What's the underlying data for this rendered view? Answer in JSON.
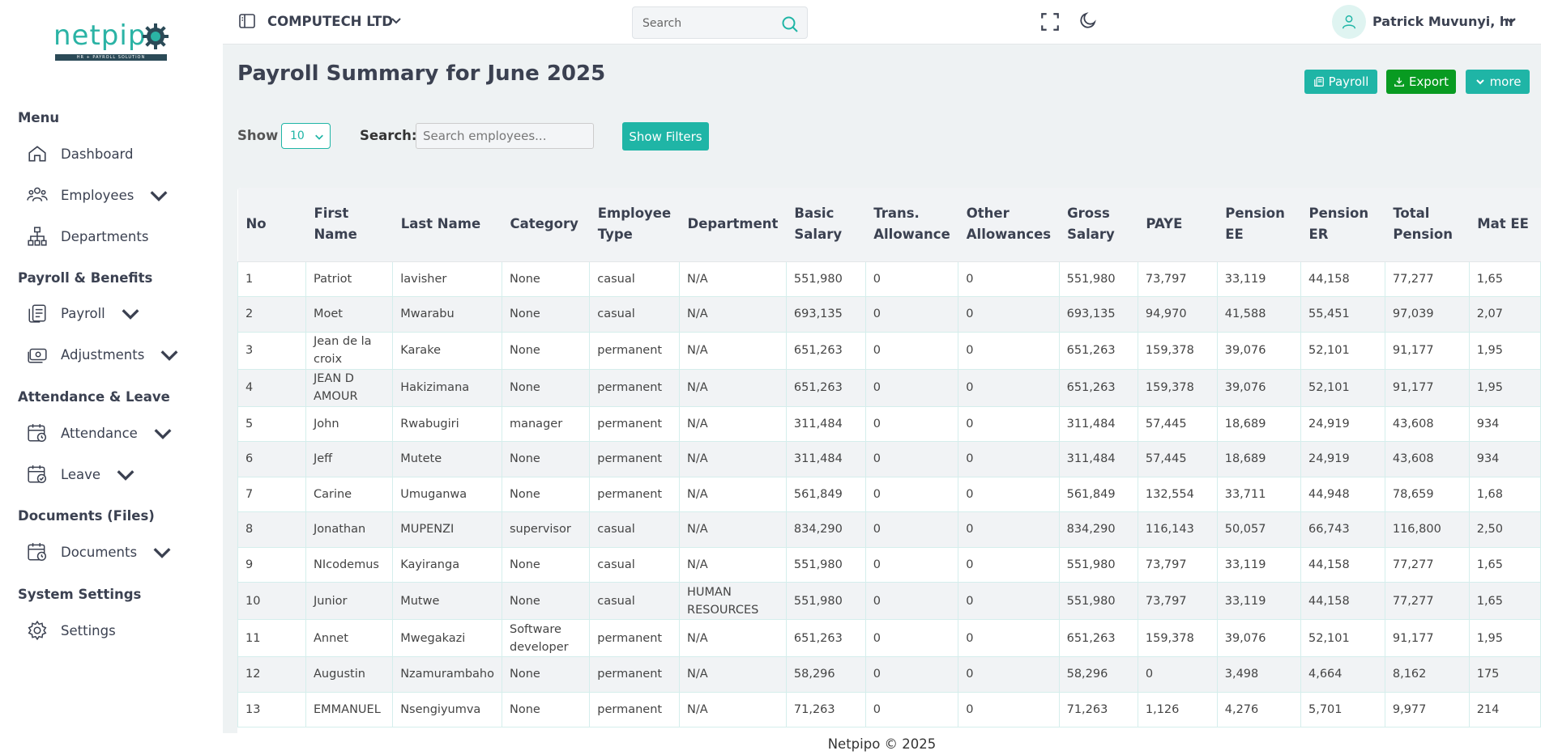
{
  "brand": {
    "logo_text": "netpip",
    "tagline": "HR + PAYROLL SOLUTION"
  },
  "sidebar": {
    "sections": [
      {
        "title": "Menu"
      },
      {
        "title": "Payroll & Benefits"
      },
      {
        "title": "Attendance & Leave"
      },
      {
        "title": "Documents (Files)"
      },
      {
        "title": "System Settings"
      }
    ],
    "items": [
      {
        "label": "Dashboard"
      },
      {
        "label": "Employees"
      },
      {
        "label": "Departments"
      },
      {
        "label": "Payroll"
      },
      {
        "label": "Adjustments"
      },
      {
        "label": "Attendance"
      },
      {
        "label": "Leave"
      },
      {
        "label": "Documents"
      },
      {
        "label": "Settings"
      }
    ]
  },
  "topbar": {
    "company": "COMPUTECH LTD",
    "search_placeholder": "Search",
    "user": "Patrick Muvunyi, hr"
  },
  "page": {
    "title": "Payroll Summary for June 2025",
    "buttons": {
      "payroll": "Payroll",
      "export": "Export",
      "more": "more"
    },
    "show_label": "Show",
    "show_value": "10",
    "search_label": "Search:",
    "search_placeholder": "Search employees...",
    "filters_button": "Show Filters"
  },
  "table": {
    "headers": [
      "No",
      "First Name",
      "Last Name",
      "Category",
      "Employee Type",
      "Department",
      "Basic Salary",
      "Trans. Allowance",
      "Other Allowances",
      "Gross Salary",
      "PAYE",
      "Pension EE",
      "Pension ER",
      "Total Pension",
      "Mat EE"
    ],
    "rows": [
      [
        "1",
        "Patriot",
        "lavisher",
        "None",
        "casual",
        "N/A",
        "551,980",
        "0",
        "0",
        "551,980",
        "73,797",
        "33,119",
        "44,158",
        "77,277",
        "1,65"
      ],
      [
        "2",
        "Moet",
        "Mwarabu",
        "None",
        "casual",
        "N/A",
        "693,135",
        "0",
        "0",
        "693,135",
        "94,970",
        "41,588",
        "55,451",
        "97,039",
        "2,07"
      ],
      [
        "3",
        "Jean de la croix",
        "Karake",
        "None",
        "permanent",
        "N/A",
        "651,263",
        "0",
        "0",
        "651,263",
        "159,378",
        "39,076",
        "52,101",
        "91,177",
        "1,95"
      ],
      [
        "4",
        "JEAN D AMOUR",
        "Hakizimana",
        "None",
        "permanent",
        "N/A",
        "651,263",
        "0",
        "0",
        "651,263",
        "159,378",
        "39,076",
        "52,101",
        "91,177",
        "1,95"
      ],
      [
        "5",
        "John",
        "Rwabugiri",
        "manager",
        "permanent",
        "N/A",
        "311,484",
        "0",
        "0",
        "311,484",
        "57,445",
        "18,689",
        "24,919",
        "43,608",
        "934"
      ],
      [
        "6",
        "Jeff",
        "Mutete",
        "None",
        "permanent",
        "N/A",
        "311,484",
        "0",
        "0",
        "311,484",
        "57,445",
        "18,689",
        "24,919",
        "43,608",
        "934"
      ],
      [
        "7",
        "Carine",
        "Umuganwa",
        "None",
        "permanent",
        "N/A",
        "561,849",
        "0",
        "0",
        "561,849",
        "132,554",
        "33,711",
        "44,948",
        "78,659",
        "1,68"
      ],
      [
        "8",
        "Jonathan",
        "MUPENZI",
        "supervisor",
        "casual",
        "N/A",
        "834,290",
        "0",
        "0",
        "834,290",
        "116,143",
        "50,057",
        "66,743",
        "116,800",
        "2,50"
      ],
      [
        "9",
        "NIcodemus",
        "Kayiranga",
        "None",
        "casual",
        "N/A",
        "551,980",
        "0",
        "0",
        "551,980",
        "73,797",
        "33,119",
        "44,158",
        "77,277",
        "1,65"
      ],
      [
        "10",
        "Junior",
        "Mutwe",
        "None",
        "casual",
        "HUMAN RESOURCES",
        "551,980",
        "0",
        "0",
        "551,980",
        "73,797",
        "33,119",
        "44,158",
        "77,277",
        "1,65"
      ],
      [
        "11",
        "Annet",
        "Mwegakazi",
        "Software developer",
        "permanent",
        "N/A",
        "651,263",
        "0",
        "0",
        "651,263",
        "159,378",
        "39,076",
        "52,101",
        "91,177",
        "1,95"
      ],
      [
        "12",
        "Augustin",
        "Nzamurambaho",
        "None",
        "permanent",
        "N/A",
        "58,296",
        "0",
        "0",
        "58,296",
        "0",
        "3,498",
        "4,664",
        "8,162",
        "175"
      ],
      [
        "13",
        "EMMANUEL",
        "Nsengiyumva",
        "None",
        "permanent",
        "N/A",
        "71,263",
        "0",
        "0",
        "71,263",
        "1,126",
        "4,276",
        "5,701",
        "9,977",
        "214"
      ]
    ]
  },
  "footer": "Netpipo © 2025",
  "colors": {
    "accent": "#1fb5a6",
    "export": "#089b21",
    "text": "#3b4151"
  }
}
